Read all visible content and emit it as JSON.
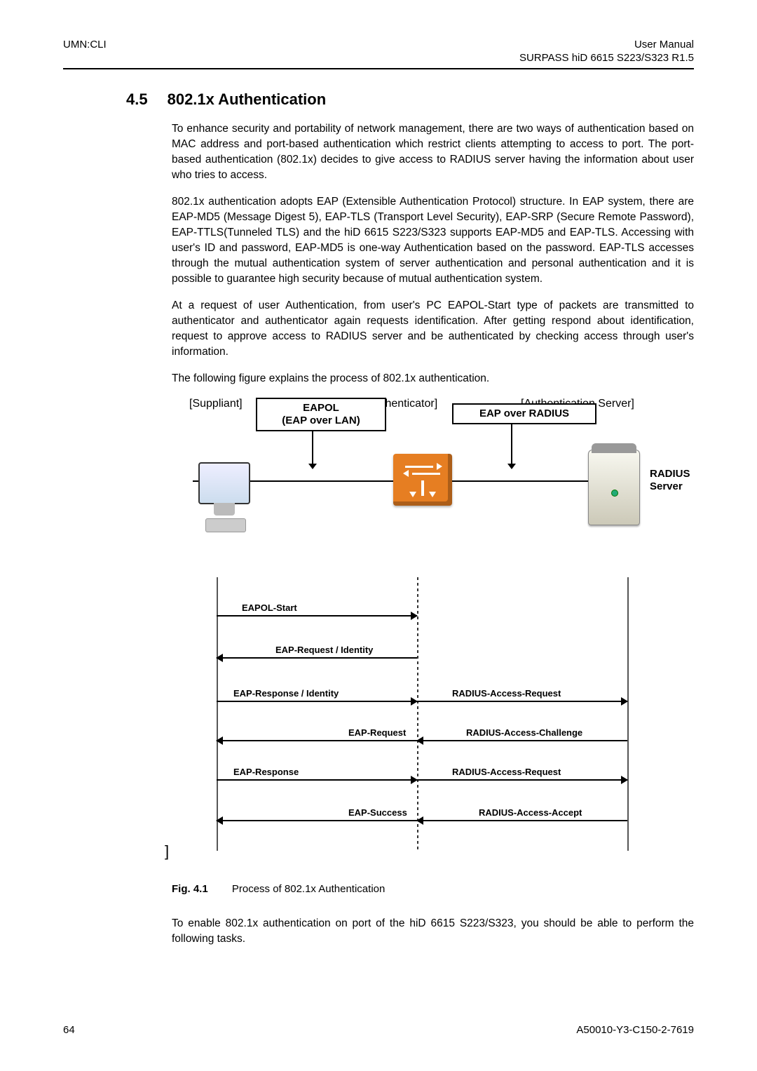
{
  "header": {
    "left": "UMN:CLI",
    "right_top": "User Manual",
    "right_sub": "SURPASS hiD 6615 S223/S323 R1.5"
  },
  "section": {
    "num": "4.5",
    "title": "802.1x Authentication"
  },
  "paragraphs": {
    "p1": "To enhance security and portability of network management, there are two ways of authentication based on MAC address and port-based authentication which restrict clients attempting to access to port. The port-based authentication (802.1x) decides to give access to RADIUS server having the information about user who tries to access.",
    "p2": "802.1x authentication adopts EAP (Extensible Authentication Protocol) structure. In EAP system, there are EAP-MD5 (Message Digest 5), EAP-TLS (Transport Level Security), EAP-SRP (Secure Remote Password), EAP-TTLS(Tunneled TLS) and the hiD 6615 S223/S323 supports EAP-MD5 and EAP-TLS. Accessing with user's ID and password, EAP-MD5 is one-way Authentication based on the password. EAP-TLS accesses through the mutual authentication system of server authentication and personal authentication and it is possible to guarantee high security because of mutual authentication system.",
    "p3": "At a request of user Authentication, from user's PC EAPOL-Start type of packets are transmitted to authenticator and authenticator again requests identification. After getting respond about identification, request to approve access to RADIUS server and be authenticated by checking access through user's information.",
    "p4": "The following figure explains the process of 802.1x authentication.",
    "p5": "To enable 802.1x authentication on port of the hiD 6615 S223/S323, you should be able to perform the following tasks."
  },
  "figure": {
    "labels": {
      "eapol_box_l1": "EAPOL",
      "eapol_box_l2": "(EAP over LAN)",
      "radius_box": "EAP over RADIUS",
      "radius_server_l1": "RADIUS",
      "radius_server_l2": "Server",
      "role1": "[Suppliant]",
      "role2": "[Authenticator]",
      "role3": "[Authentication Server]"
    },
    "messages": {
      "m1": "EAPOL-Start",
      "m2": "EAP-Request / Identity",
      "m3l": "EAP-Response / Identity",
      "m3r": "RADIUS-Access-Request",
      "m4l": "EAP-Request",
      "m4r": "RADIUS-Access-Challenge",
      "m5l": "EAP-Response",
      "m5r": "RADIUS-Access-Request",
      "m6l": "EAP-Success",
      "m6r": "RADIUS-Access-Accept"
    },
    "caption_num": "Fig. 4.1",
    "caption_text": "Process of 802.1x Authentication"
  },
  "footer": {
    "page": "64",
    "doc_id": "A50010-Y3-C150-2-7619"
  }
}
